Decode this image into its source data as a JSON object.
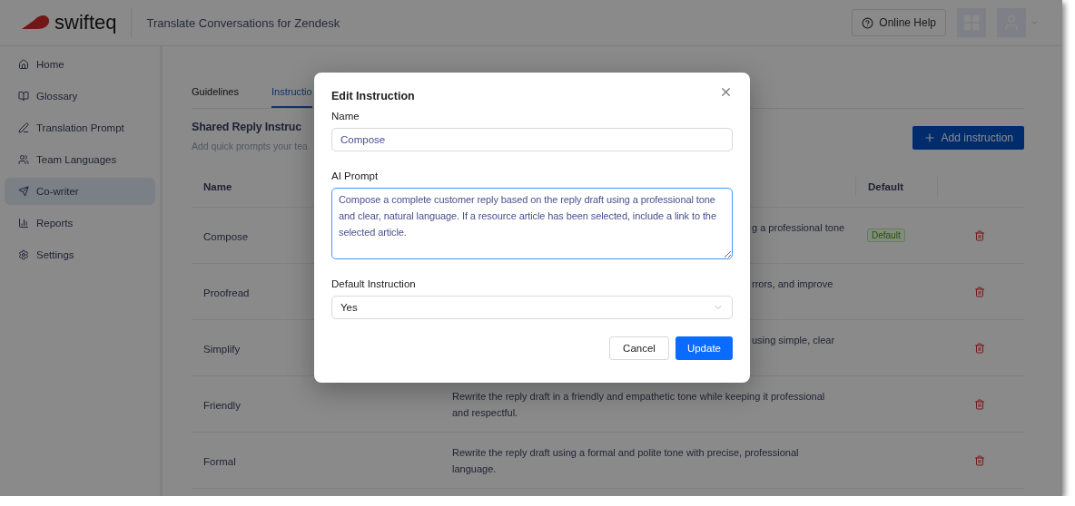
{
  "app": {
    "logo_text": "swifteq",
    "product": "Translate Conversations for Zendesk",
    "help_button": "Online Help"
  },
  "sidebar": {
    "items": [
      {
        "label": "Home",
        "selected": false
      },
      {
        "label": "Glossary",
        "selected": false
      },
      {
        "label": "Translation Prompt",
        "selected": false
      },
      {
        "label": "Team Languages",
        "selected": false
      },
      {
        "label": "Co-writer",
        "selected": true
      },
      {
        "label": "Reports",
        "selected": false
      },
      {
        "label": "Settings",
        "selected": false
      }
    ]
  },
  "tabs": [
    {
      "label": "Guidelines",
      "selected": false
    },
    {
      "label": "Instructio",
      "selected": true
    }
  ],
  "section": {
    "title": "Shared Reply Instruc",
    "subtitle": "Add quick prompts your tea",
    "add_button": "Add instruction"
  },
  "table": {
    "name_column": "Name",
    "default_column": "Default",
    "rows": [
      {
        "name": "Compose",
        "description_lines": [
          "g a professional tone"
        ],
        "partly_hidden": true,
        "is_default": true,
        "badge": "Default"
      },
      {
        "name": "Proofread",
        "description_lines": [
          "rrors, and improve"
        ],
        "partly_hidden": true,
        "is_default": false
      },
      {
        "name": "Simplify",
        "description_lines": [
          "using simple, clear"
        ],
        "partly_hidden": true,
        "is_default": false
      },
      {
        "name": "Friendly",
        "description_lines": [
          "Rewrite the reply draft in a friendly and empathetic tone while keeping it professional",
          "and respectful."
        ],
        "partly_hidden": false,
        "is_default": false
      },
      {
        "name": "Formal",
        "description_lines": [
          "Rewrite the reply draft using a formal and polite tone with precise, professional",
          "language."
        ],
        "partly_hidden": false,
        "is_default": false
      }
    ]
  },
  "dialog": {
    "title": "Edit Instruction",
    "name_label": "Name",
    "name_value": "Compose",
    "prompt_label": "AI Prompt",
    "prompt_value": "Compose a complete customer reply based on the reply draft using a professional tone and clear, natural language. If a resource article has been selected, include a link to the selected article.",
    "default_label": "Default Instruction",
    "default_value": "Yes",
    "cancel_button": "Cancel",
    "update_button": "Update"
  }
}
